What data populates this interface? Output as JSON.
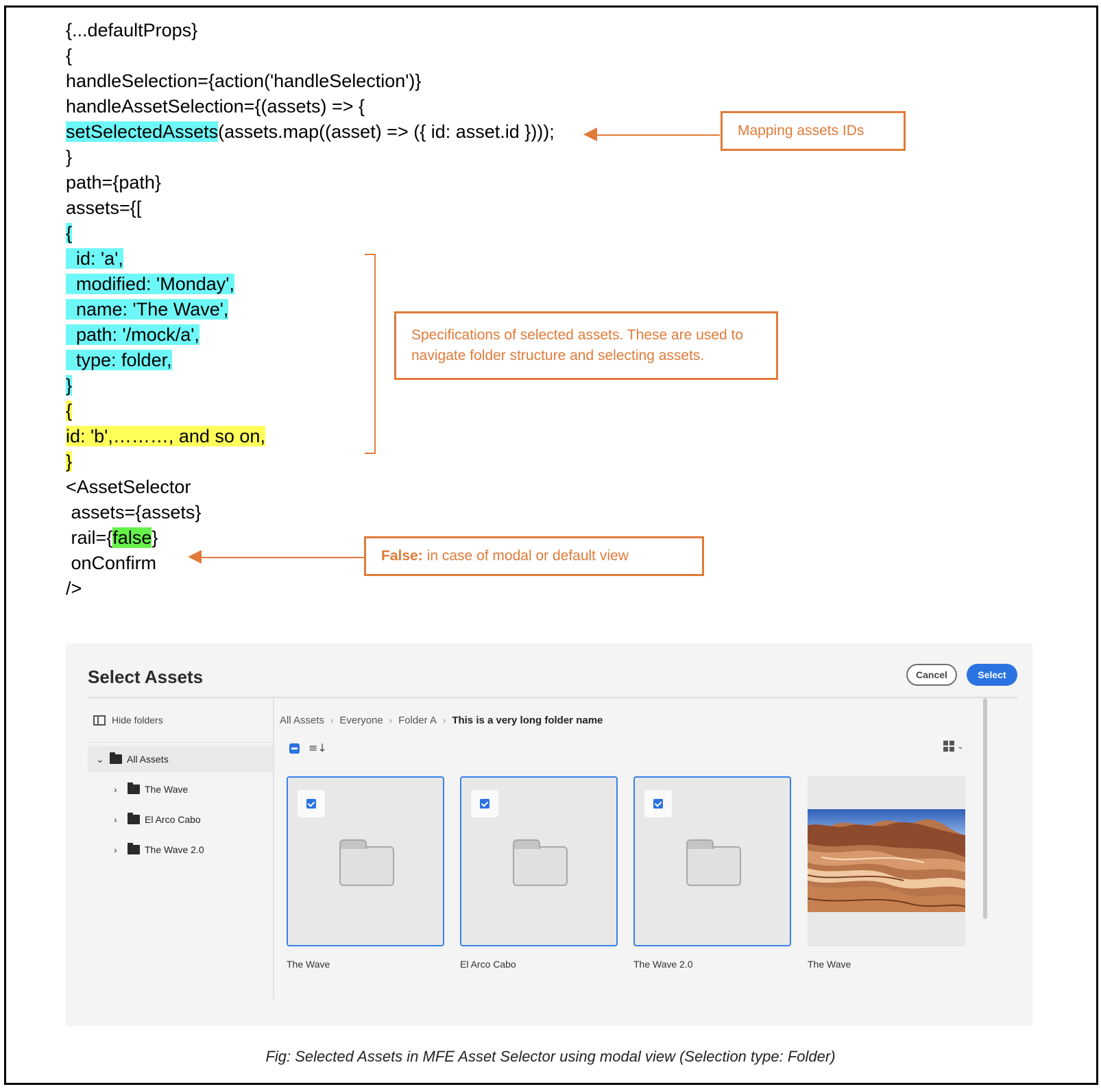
{
  "code": {
    "lines": [
      "{...defaultProps}",
      "{",
      "handleSelection={action('handleSelection')}",
      "handleAssetSelection={(assets) => {",
      "setSelectedAssets",
      "(assets.map((asset) => ({ id: asset.id })));",
      "}",
      "path={path}",
      "assets={[",
      "{",
      "  id: 'a',",
      "  modified: 'Monday',",
      "  name: 'The Wave',",
      "  path: '/mock/a',",
      "  type: folder,",
      "}",
      "{",
      "id: 'b',………, and so on,",
      "}",
      "<AssetSelector",
      " assets={assets}",
      " rail={",
      "false",
      "}",
      " onConfirm",
      "/>"
    ]
  },
  "annotations": {
    "mapping": "Mapping assets IDs",
    "specs": "Specifications of selected assets. These are used to navigate folder structure and selecting assets.",
    "false_bold": "False:",
    "false_rest": "in case of modal or default view"
  },
  "ui": {
    "title": "Select Assets",
    "cancel": "Cancel",
    "select": "Select",
    "hide_folders": "Hide folders",
    "tree": {
      "root": "All Assets",
      "items": [
        "The Wave",
        "El Arco Cabo",
        "The Wave 2.0"
      ]
    },
    "breadcrumb": [
      "All Assets",
      "Everyone",
      "Folder A",
      "This is a very long folder name"
    ],
    "cards": [
      "The Wave",
      "El Arco Cabo",
      "The Wave 2.0",
      "The Wave"
    ]
  },
  "caption": "Fig: Selected Assets in MFE Asset Selector using modal view (Selection type: Folder)",
  "colors": {
    "accent": "#e07b39",
    "highlight_cyan": "#6ef7f7",
    "highlight_yellow": "#ffff5a",
    "highlight_green": "#66f04a",
    "primary": "#2b73e1"
  }
}
